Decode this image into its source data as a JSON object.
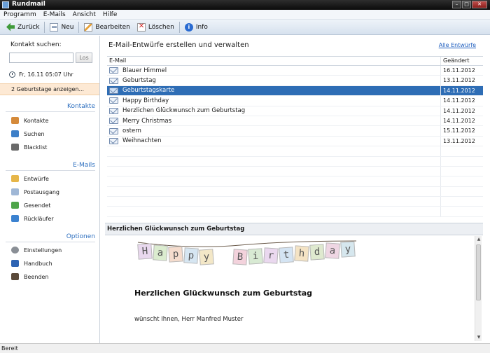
{
  "window": {
    "title": "Rundmail"
  },
  "menu": [
    {
      "label": "Programm",
      "accel": "P"
    },
    {
      "label": "E-Mails",
      "accel": "E"
    },
    {
      "label": "Ansicht",
      "accel": "A"
    },
    {
      "label": "Hilfe",
      "accel": "H"
    }
  ],
  "toolbar": {
    "back_label": "Zurück",
    "new_label": "Neu",
    "edit_label": "Bearbeiten",
    "delete_label": "Löschen",
    "info_label": "Info"
  },
  "sidebar": {
    "search_label": "Kontakt suchen:",
    "search_value": "",
    "search_button": "Los",
    "date_text": "Fr, 16.11   05:07 Uhr",
    "birthday_notice": "2 Geburtstage anzeigen...",
    "sections": [
      {
        "title": "Kontakte",
        "items": [
          {
            "label": "Kontakte",
            "icon": "contacts-icon"
          },
          {
            "label": "Suchen",
            "icon": "search-people-icon"
          },
          {
            "label": "Blacklist",
            "icon": "blacklist-icon"
          }
        ]
      },
      {
        "title": "E-Mails",
        "items": [
          {
            "label": "Entwürfe",
            "icon": "drafts-folder-icon"
          },
          {
            "label": "Postausgang",
            "icon": "outbox-icon"
          },
          {
            "label": "Gesendet",
            "icon": "sent-icon"
          },
          {
            "label": "Rückläufer",
            "icon": "bounce-icon"
          }
        ]
      },
      {
        "title": "Optionen",
        "items": [
          {
            "label": "Einstellungen",
            "icon": "settings-icon"
          },
          {
            "label": "Handbuch",
            "icon": "manual-icon"
          },
          {
            "label": "Beenden",
            "icon": "exit-icon"
          }
        ]
      }
    ]
  },
  "main": {
    "title": "E-Mail-Entwürfe erstellen und verwalten",
    "all_link": "Alle Entwürfe",
    "columns": [
      "E-Mail",
      "Geändert"
    ],
    "rows": [
      {
        "name": "Blauer Himmel",
        "date": "16.11.2012",
        "selected": false
      },
      {
        "name": "Geburtstag",
        "date": "13.11.2012",
        "selected": false
      },
      {
        "name": "Geburtstagskarte",
        "date": "14.11.2012",
        "selected": true
      },
      {
        "name": "Happy Birthday",
        "date": "14.11.2012",
        "selected": false
      },
      {
        "name": "Herzlichen Glückwunsch zum Geburtstag",
        "date": "14.11.2012",
        "selected": false
      },
      {
        "name": "Merry Christmas",
        "date": "14.11.2012",
        "selected": false
      },
      {
        "name": "ostern",
        "date": "15.11.2012",
        "selected": false
      },
      {
        "name": "Weihnachten",
        "date": "13.11.2012",
        "selected": false
      }
    ]
  },
  "preview": {
    "header": "Herzlichen Glückwunsch zum Geburtstag",
    "banner_letters": [
      "H",
      "a",
      "p",
      "p",
      "y",
      "B",
      "i",
      "r",
      "t",
      "h",
      "d",
      "a",
      "y"
    ],
    "headline": "Herzlichen Glückwunsch zum Geburtstag",
    "subline": "wünscht Ihnen, Herr Manfred Muster"
  },
  "status": {
    "text": "Bereit"
  }
}
